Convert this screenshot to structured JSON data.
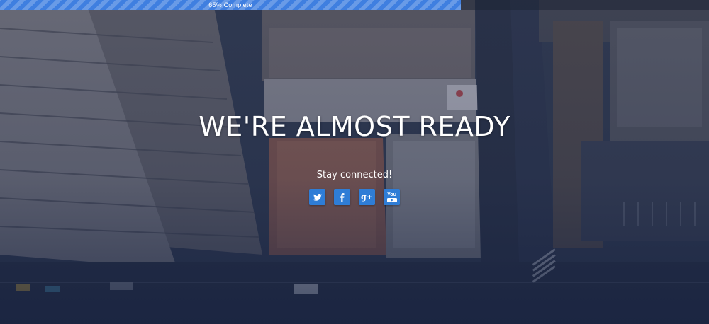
{
  "progress": {
    "label": "65% Complete",
    "percent": 65,
    "fill_color": "#3f7fe0"
  },
  "hero": {
    "title": "WE'RE ALMOST READY",
    "subtitle": "Stay connected!"
  },
  "social": {
    "accent_color": "#2f7dd6",
    "items": [
      {
        "icon": "twitter-icon"
      },
      {
        "icon": "facebook-icon"
      },
      {
        "icon": "google-plus-icon",
        "glyph": "g+"
      },
      {
        "icon": "youtube-icon",
        "glyph": "You"
      }
    ]
  }
}
